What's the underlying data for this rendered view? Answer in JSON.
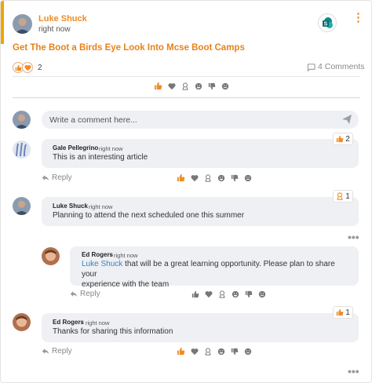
{
  "post": {
    "author": "Luke Shuck",
    "time": "right now",
    "title": "Get The Boot a Birds Eye Look Into Mcse Boot Camps",
    "reaction_count": "2",
    "comments_label": "4 Comments"
  },
  "composer": {
    "placeholder": "Write a comment here..."
  },
  "comments": [
    {
      "author": "Gale Pellegrino",
      "separator": "-",
      "time": "right now",
      "text": "This is an interesting article",
      "badge_count": "2",
      "badge_icon": "thumbs-up-icon",
      "reply_label": "Reply"
    },
    {
      "author": "Luke Shuck",
      "separator": "-",
      "time": "right now",
      "text": "Planning to attend the next scheduled one this summer",
      "badge_count": "1",
      "badge_icon": "award-icon"
    },
    {
      "author": "Ed Rogers",
      "separator": "-",
      "time": "right now",
      "mention": "Luke Shuck",
      "text_line1": "that will be a great learning opportunity. Please plan to share your",
      "text_line2": "experience with the team",
      "reply_label": "Reply"
    },
    {
      "author": "Ed Rogers",
      "separator": "-",
      "time": "right now",
      "text": "Thanks for sharing this information",
      "badge_count": "1",
      "badge_icon": "thumbs-up-icon",
      "reply_label": "Reply"
    }
  ],
  "icons": {
    "reactions": [
      "thumbs-up-icon",
      "heart-icon",
      "award-icon",
      "smile-icon",
      "thumbs-down-icon",
      "sad-icon"
    ],
    "more": "more-dots-icon",
    "kebab": "kebab-icon",
    "comment": "comment-icon",
    "send": "send-icon",
    "reply": "reply-icon"
  },
  "colors": {
    "accent": "#f08c24",
    "active_reaction": "#f08c24",
    "inactive_reaction": "#777777",
    "mention": "#3b7fc4",
    "bubble": "#eef0f3"
  }
}
